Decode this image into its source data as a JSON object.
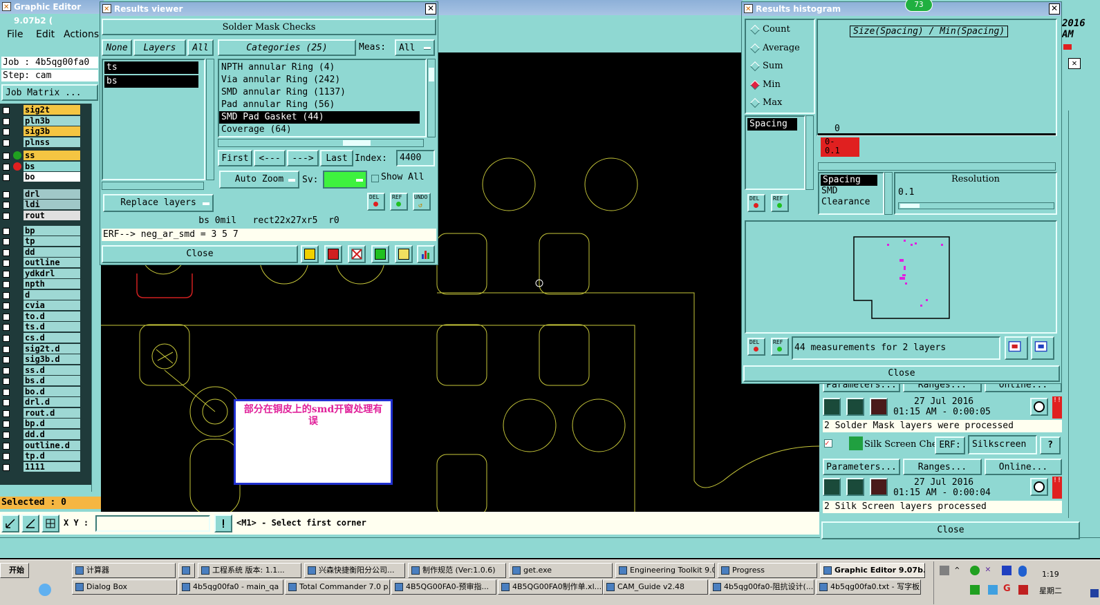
{
  "main_window": {
    "title": "Graphic Editor 9.07b2 (",
    "menu": [
      "File",
      "Edit",
      "Actions"
    ],
    "job_label": "Job : 4b5qg00fa0",
    "step_label": "Step: cam",
    "job_matrix_label": "Job Matrix ...",
    "right_edge_text": [
      "2016",
      "AM"
    ],
    "layers": [
      {
        "name": "sig2t",
        "color": "#f5c542"
      },
      {
        "name": "pln3b",
        "color": "#9ed8d4"
      },
      {
        "name": "sig3b",
        "color": "#f5c542"
      },
      {
        "name": "plnss",
        "color": "#9ed8d4"
      },
      {
        "name": "ss",
        "color": "#f5c542"
      },
      {
        "name": "bs",
        "color": "#8fd8d2"
      },
      {
        "name": "bo",
        "color": "#ffffff"
      },
      {
        "name": "drl",
        "color": "#a0c8c8"
      },
      {
        "name": "ldi",
        "color": "#a0c8c8"
      },
      {
        "name": "rout",
        "color": "#e0e0e0"
      },
      {
        "name": "bp",
        "color": "#9ed8d4"
      },
      {
        "name": "tp",
        "color": "#9ed8d4"
      },
      {
        "name": "dd",
        "color": "#9ed8d4"
      },
      {
        "name": "outline",
        "color": "#9ed8d4"
      },
      {
        "name": "ydkdrl",
        "color": "#9ed8d4"
      },
      {
        "name": "npth",
        "color": "#9ed8d4"
      },
      {
        "name": "d",
        "color": "#9ed8d4"
      },
      {
        "name": "cvia",
        "color": "#9ed8d4"
      },
      {
        "name": "to.d",
        "color": "#9ed8d4"
      },
      {
        "name": "ts.d",
        "color": "#9ed8d4"
      },
      {
        "name": "cs.d",
        "color": "#9ed8d4"
      },
      {
        "name": "sig2t.d",
        "color": "#9ed8d4"
      },
      {
        "name": "sig3b.d",
        "color": "#9ed8d4"
      },
      {
        "name": "ss.d",
        "color": "#9ed8d4"
      },
      {
        "name": "bs.d",
        "color": "#9ed8d4"
      },
      {
        "name": "bo.d",
        "color": "#9ed8d4"
      },
      {
        "name": "drl.d",
        "color": "#9ed8d4"
      },
      {
        "name": "rout.d",
        "color": "#9ed8d4"
      },
      {
        "name": "bp.d",
        "color": "#9ed8d4"
      },
      {
        "name": "dd.d",
        "color": "#9ed8d4"
      },
      {
        "name": "outline.d",
        "color": "#9ed8d4"
      },
      {
        "name": "tp.d",
        "color": "#9ed8d4"
      },
      {
        "name": "1111",
        "color": "#9ed8d4"
      }
    ],
    "selected_label": "Selected : 0",
    "xy_label": "X Y :",
    "xy_value": "",
    "status_text": "<M1> - Select first corner",
    "annotation": "部分在铜皮上的smd开窗处理有误"
  },
  "results_viewer": {
    "title": "Results viewer",
    "header": "Solder Mask Checks",
    "none_btn": "None",
    "layers_btn": "Layers",
    "all_btn": "All",
    "categories_label": "Categories (25)",
    "meas_label": "Meas:",
    "meas_value": "All",
    "layer_list": [
      "ts",
      "bs"
    ],
    "categories": [
      "NPTH annular Ring (4)",
      "Via annular Ring (242)",
      "SMD annular Ring (1137)",
      "Pad annular Ring (56)",
      "SMD Pad Gasket (44)",
      "Coverage (64)"
    ],
    "selected_category_index": 4,
    "first_btn": "First",
    "prev_btn": "<---",
    "next_btn": "--->",
    "last_btn": "Last",
    "index_label": "Index:",
    "index_value": "4400",
    "auto_zoom": "Auto Zoom",
    "sv_label": "Sv:",
    "show_all": "Show All",
    "replace_layers": "Replace layers",
    "del_label": "DEL",
    "ref_label": "REF",
    "undo_label": "UNDO",
    "info_line": "bs 0mil   rect22x27xr5  r0",
    "erf_line": "ERF--> neg_ar_smd = 3 5 7",
    "close": "Close"
  },
  "histogram": {
    "title": "Results histogram",
    "badge": "73",
    "options": [
      "Count",
      "Average",
      "Sum",
      "Min",
      "Max"
    ],
    "selected_option": "Min",
    "chart_title": "Size(Spacing) / Min(Spacing)",
    "zero_label": "0",
    "bin_label": "0-\n0.1",
    "list_item": "Spacing",
    "types": [
      "Spacing",
      "SMD",
      "Clearance"
    ],
    "resolution_label": "Resolution",
    "resolution_value": "0.1",
    "measurements": "44 measurements for 2 layers",
    "close": "Close",
    "del_label": "DEL",
    "ref_label": "REF"
  },
  "checklist": {
    "params_btn": "Parameters...",
    "ranges_btn": "Ranges...",
    "online_btn": "Online...",
    "run1_date": "27 Jul 2016",
    "run1_time": "01:15 AM - 0:00:05",
    "run1_status": "2 Solder Mask layers were processed",
    "silk_label": "Silk Screen Che",
    "erf_label": "ERF:",
    "erf_value": "Silkscreen",
    "help": "?",
    "run2_date": "27 Jul 2016",
    "run2_time": "01:15 AM - 0:00:04",
    "run2_status": "2 Silk Screen layers processed",
    "close": "Close"
  },
  "taskbar": {
    "start": "开始",
    "row1": [
      "计算器",
      "",
      "工程系统  版本: 1.1...",
      "兴森快捷衡阳分公司...",
      "制作规范 (Ver:1.0.6)",
      "get.exe",
      "Engineering Toolkit 9.0...",
      "Progress",
      "Graphic Editor 9.07b..."
    ],
    "row2": [
      "Dialog Box",
      "4b5qg00fa0 - main_qa",
      "Total Commander 7.0 p...",
      "4B5QG00FA0-预审指...",
      "4B5QG00FA0制作单.xl...",
      "CAM_Guide v2.48",
      "4b5qg00fa0-阻抗设计(...",
      "4b5qg00fa0.txt - 写字板"
    ],
    "clock": "1:19",
    "day": "星期二"
  }
}
